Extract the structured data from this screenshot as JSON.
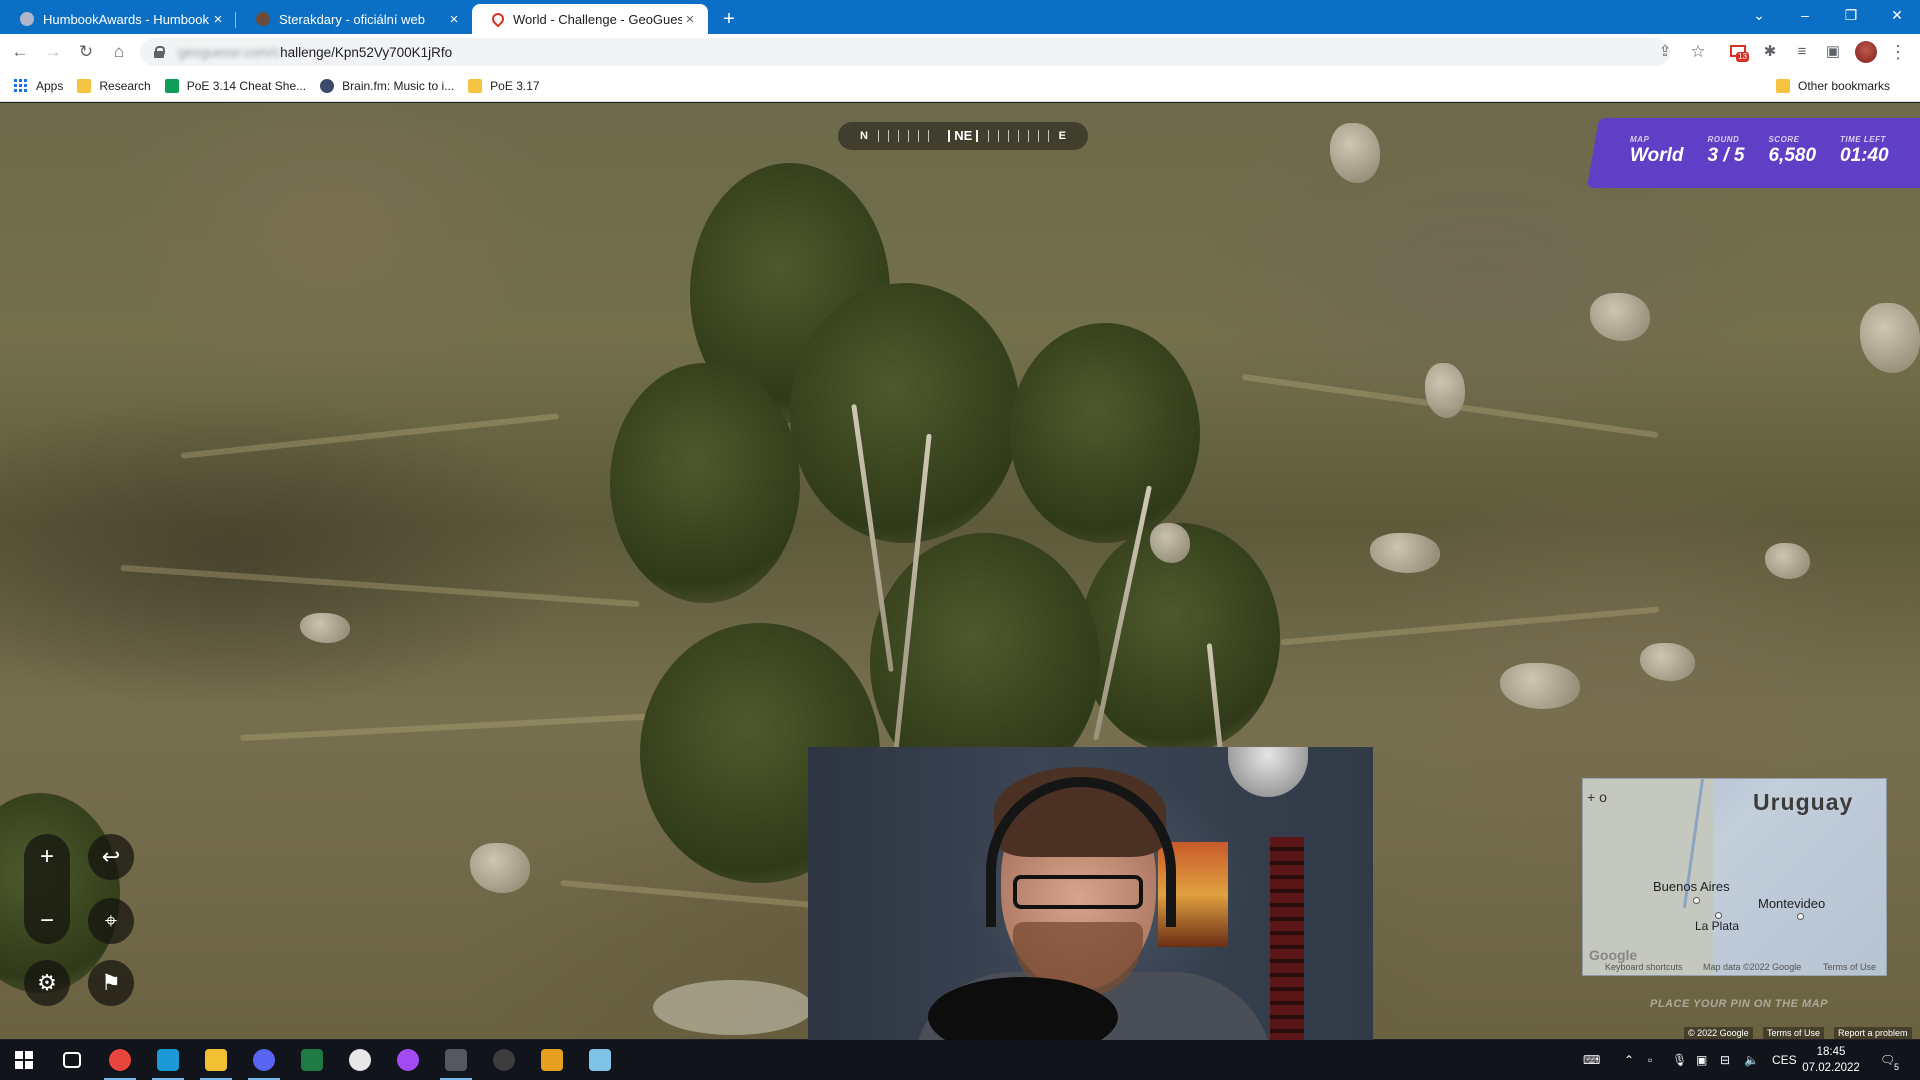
{
  "browser": {
    "tabs": [
      {
        "title": "HumbookAwards - Humbook",
        "close": "×",
        "favicon_color": "#b0b6c8"
      },
      {
        "title": "Sterakdary - oficiální web",
        "close": "×",
        "favicon_color": "#6b4c3b"
      },
      {
        "title": "World - Challenge - GeoGuessr",
        "close": "×",
        "favicon_color": "#d93025"
      }
    ],
    "new_tab": "+",
    "window_controls": {
      "tablist": "⌄",
      "minimize": "–",
      "restore": "❐",
      "close": "✕"
    },
    "url_blurred": "geoguessr.com/c",
    "url_visible": "hallenge/Kpn52Vy700K1jRfo",
    "nav": {
      "back": "←",
      "forward": "→",
      "reload": "↻",
      "home": "⌂"
    },
    "toolbar_icons": {
      "share": "⇪",
      "star": "☆",
      "mail_badge": "13",
      "extensions": "✱",
      "media": "≡",
      "sidepanel": "▣",
      "menu": "⋮"
    },
    "bookmarks": [
      {
        "label": "Apps",
        "icon": "apps-grid-icon"
      },
      {
        "label": "Research",
        "icon": "folder-icon"
      },
      {
        "label": "PoE 3.14 Cheat She...",
        "icon": "sheets-icon"
      },
      {
        "label": "Brain.fm: Music to i...",
        "icon": "brainfm-icon"
      },
      {
        "label": "PoE 3.17",
        "icon": "folder-icon"
      }
    ],
    "other_bookmarks": "Other bookmarks"
  },
  "game": {
    "compass": {
      "left": "N",
      "center": "NE",
      "right": "E"
    },
    "status": [
      {
        "label": "MAP",
        "value": "World"
      },
      {
        "label": "ROUND",
        "value": "3 / 5"
      },
      {
        "label": "SCORE",
        "value": "6,580"
      },
      {
        "label": "TIME LEFT",
        "value": "01:40"
      }
    ],
    "controls": {
      "zoom_in": "+",
      "zoom_out": "−",
      "undo": "↩",
      "set_start": "⌖",
      "settings": "⚙",
      "flag": "⚑"
    },
    "minimap": {
      "country": "Uruguay",
      "cities": [
        "Buenos Aires",
        "Montevideo",
        "La Plata"
      ],
      "zoom_ctrl": "+ o",
      "keyboard": "Keyboard shortcuts",
      "mapdata": "Map data ©2022 Google",
      "terms": "Terms of Use",
      "logo": "Google"
    },
    "place_pin": "PLACE YOUR PIN ON THE MAP",
    "footer": {
      "copyright": "© 2022 Google",
      "terms": "Terms of Use",
      "report": "Report a problem"
    }
  },
  "taskbar": {
    "apps": [
      {
        "name": "task-view",
        "color": "#ffffff"
      },
      {
        "name": "chrome",
        "color": "#e8453c"
      },
      {
        "name": "steam",
        "color": "#1b9ad6"
      },
      {
        "name": "file-explorer",
        "color": "#f2c033"
      },
      {
        "name": "discord",
        "color": "#5865f2"
      },
      {
        "name": "excel",
        "color": "#1f7a45"
      },
      {
        "name": "app-compass",
        "color": "#e8e8e8"
      },
      {
        "name": "messenger",
        "color": "#a24bf4"
      },
      {
        "name": "app-calculator",
        "color": "#55585f"
      },
      {
        "name": "obs",
        "color": "#3d3d3d"
      },
      {
        "name": "app-b",
        "color": "#e6a020"
      },
      {
        "name": "notepad",
        "color": "#7fc3e8"
      }
    ],
    "tray": {
      "lang": "CES",
      "notif_badge": "5"
    },
    "time": "18:45",
    "date": "07.02.2022"
  }
}
